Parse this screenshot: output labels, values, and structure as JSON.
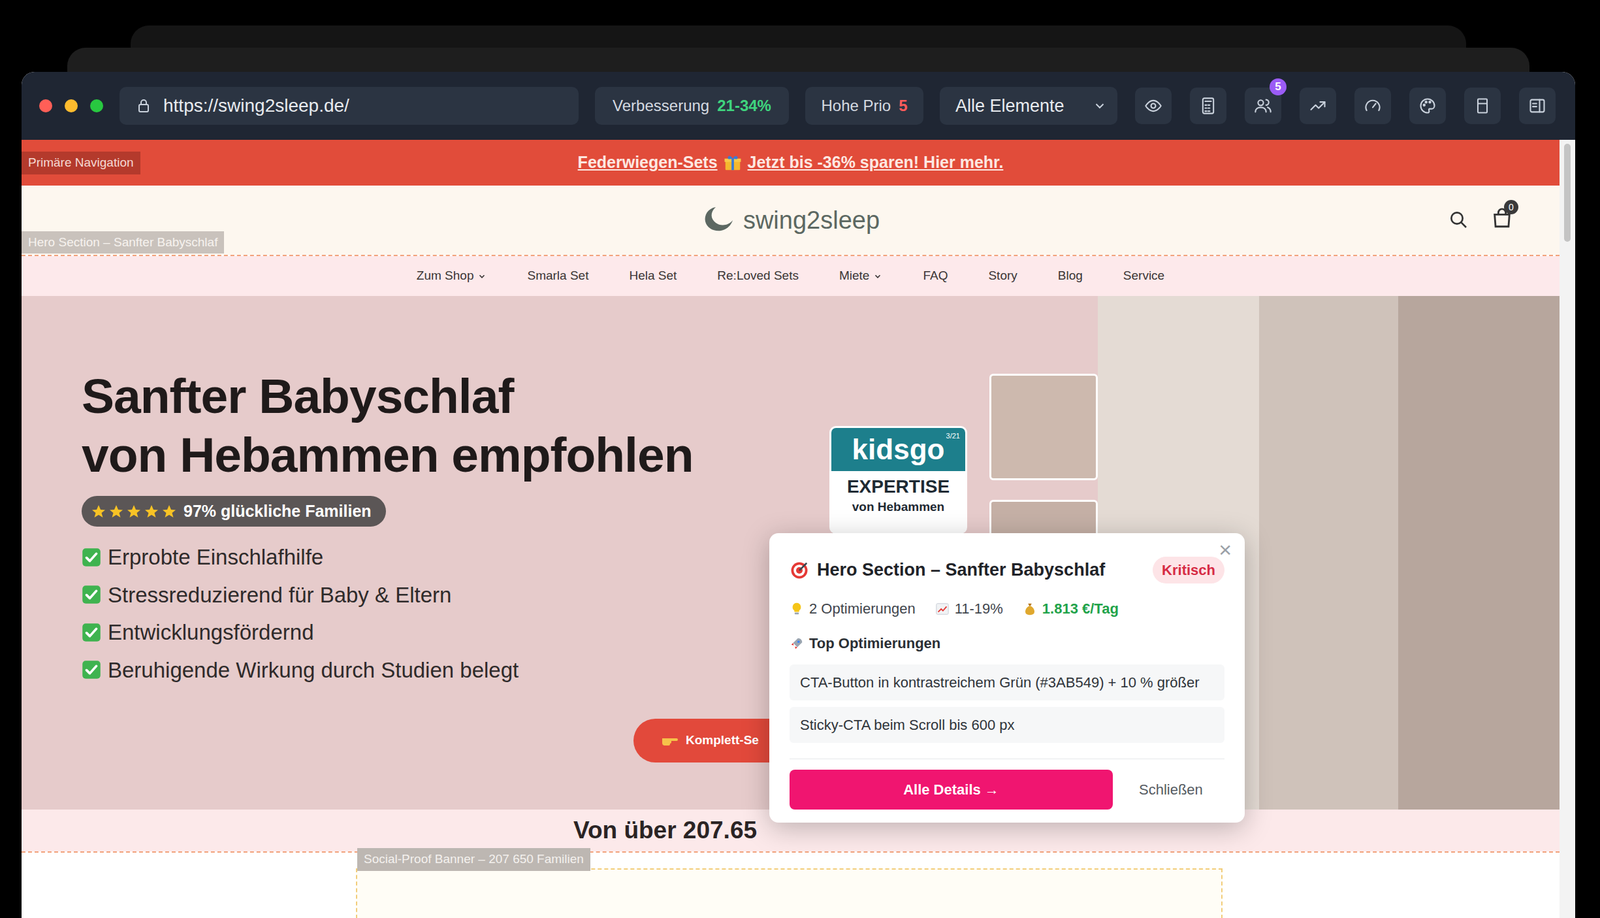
{
  "window": {
    "url": "https://swing2sleep.de/"
  },
  "toolbar": {
    "improvement": {
      "label": "Verbesserung",
      "value": "21-34%"
    },
    "priority": {
      "label": "Hohe Prio",
      "value": "5"
    },
    "filter": "Alle Elemente",
    "team_badge": "5"
  },
  "labels": {
    "navigation": "Primäre Navigation",
    "hero": "Hero Section – Sanfter Babyschlaf",
    "social_proof": "Social-Proof Banner – 207 650 Familien"
  },
  "site": {
    "announcement": {
      "before": "Federwiegen-Sets",
      "after": "Jetzt bis -36% sparen! Hier mehr."
    },
    "logo": "swing2sleep",
    "cart_count": "0",
    "nav": [
      {
        "label": "Zum Shop",
        "dropdown": true
      },
      {
        "label": "Smarla Set",
        "dropdown": false
      },
      {
        "label": "Hela Set",
        "dropdown": false
      },
      {
        "label": "Re:Loved Sets",
        "dropdown": false
      },
      {
        "label": "Miete",
        "dropdown": true
      },
      {
        "label": "FAQ",
        "dropdown": false
      },
      {
        "label": "Story",
        "dropdown": false
      },
      {
        "label": "Blog",
        "dropdown": false
      },
      {
        "label": "Service",
        "dropdown": false
      }
    ],
    "hero": {
      "heading": [
        "Sanfter Babyschlaf",
        "von Hebammen empfohlen"
      ],
      "rating": {
        "stars": 5,
        "text": "97% glückliche Familien"
      },
      "benefits": [
        "Erprobte Einschlafhilfe",
        "Stressreduzierend für Baby & Eltern",
        "Entwicklungsfördernd",
        "Beruhigende Wirkung durch Studien belegt"
      ],
      "cta": "Komplett-Se",
      "badge": {
        "brand": "kidsgo",
        "issue": "3/21",
        "title": "EXPERTISE",
        "subtitle": "von Hebammen"
      }
    },
    "social_proof": "Von über 207.65"
  },
  "popup": {
    "title": "Hero Section – Sanfter Babyschlaf",
    "severity": "Kritisch",
    "close": "×",
    "stats": [
      {
        "kind": "count",
        "text": "2 Optimierungen"
      },
      {
        "kind": "range",
        "text": "11-19%"
      },
      {
        "kind": "revenue",
        "text": "1.813 €/Tag"
      }
    ],
    "section_title": "Top Optimierungen",
    "items": [
      "CTA-Button in kontrastreichem Grün (#3AB549) + 10 % größer",
      "Sticky-CTA beim Scroll bis 600 px"
    ],
    "primary_button": "Alle Details →",
    "secondary_button": "Schließen"
  }
}
